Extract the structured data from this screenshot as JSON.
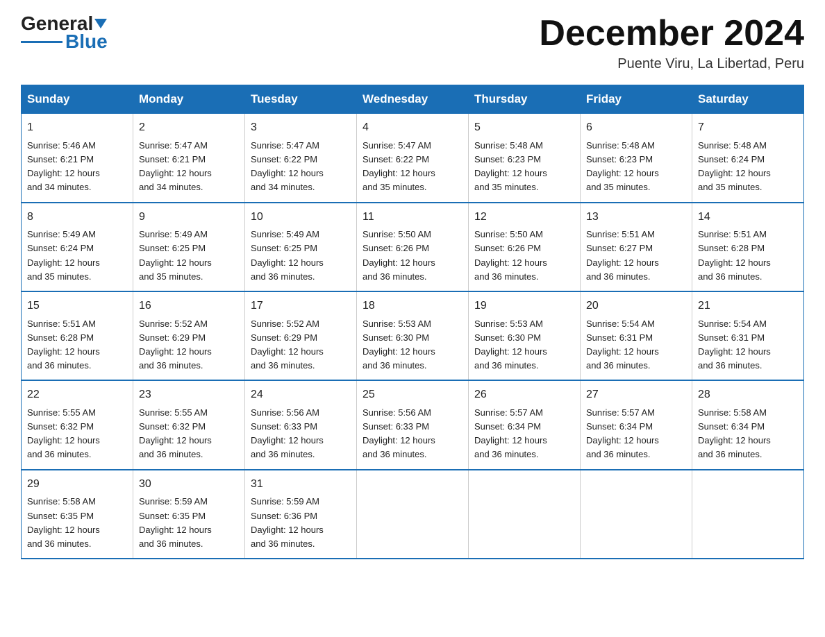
{
  "header": {
    "logo_general": "General",
    "logo_blue": "Blue",
    "month_title": "December 2024",
    "location": "Puente Viru, La Libertad, Peru"
  },
  "weekdays": [
    "Sunday",
    "Monday",
    "Tuesday",
    "Wednesday",
    "Thursday",
    "Friday",
    "Saturday"
  ],
  "weeks": [
    [
      {
        "day": "1",
        "info": "Sunrise: 5:46 AM\nSunset: 6:21 PM\nDaylight: 12 hours\nand 34 minutes."
      },
      {
        "day": "2",
        "info": "Sunrise: 5:47 AM\nSunset: 6:21 PM\nDaylight: 12 hours\nand 34 minutes."
      },
      {
        "day": "3",
        "info": "Sunrise: 5:47 AM\nSunset: 6:22 PM\nDaylight: 12 hours\nand 34 minutes."
      },
      {
        "day": "4",
        "info": "Sunrise: 5:47 AM\nSunset: 6:22 PM\nDaylight: 12 hours\nand 35 minutes."
      },
      {
        "day": "5",
        "info": "Sunrise: 5:48 AM\nSunset: 6:23 PM\nDaylight: 12 hours\nand 35 minutes."
      },
      {
        "day": "6",
        "info": "Sunrise: 5:48 AM\nSunset: 6:23 PM\nDaylight: 12 hours\nand 35 minutes."
      },
      {
        "day": "7",
        "info": "Sunrise: 5:48 AM\nSunset: 6:24 PM\nDaylight: 12 hours\nand 35 minutes."
      }
    ],
    [
      {
        "day": "8",
        "info": "Sunrise: 5:49 AM\nSunset: 6:24 PM\nDaylight: 12 hours\nand 35 minutes."
      },
      {
        "day": "9",
        "info": "Sunrise: 5:49 AM\nSunset: 6:25 PM\nDaylight: 12 hours\nand 35 minutes."
      },
      {
        "day": "10",
        "info": "Sunrise: 5:49 AM\nSunset: 6:25 PM\nDaylight: 12 hours\nand 36 minutes."
      },
      {
        "day": "11",
        "info": "Sunrise: 5:50 AM\nSunset: 6:26 PM\nDaylight: 12 hours\nand 36 minutes."
      },
      {
        "day": "12",
        "info": "Sunrise: 5:50 AM\nSunset: 6:26 PM\nDaylight: 12 hours\nand 36 minutes."
      },
      {
        "day": "13",
        "info": "Sunrise: 5:51 AM\nSunset: 6:27 PM\nDaylight: 12 hours\nand 36 minutes."
      },
      {
        "day": "14",
        "info": "Sunrise: 5:51 AM\nSunset: 6:28 PM\nDaylight: 12 hours\nand 36 minutes."
      }
    ],
    [
      {
        "day": "15",
        "info": "Sunrise: 5:51 AM\nSunset: 6:28 PM\nDaylight: 12 hours\nand 36 minutes."
      },
      {
        "day": "16",
        "info": "Sunrise: 5:52 AM\nSunset: 6:29 PM\nDaylight: 12 hours\nand 36 minutes."
      },
      {
        "day": "17",
        "info": "Sunrise: 5:52 AM\nSunset: 6:29 PM\nDaylight: 12 hours\nand 36 minutes."
      },
      {
        "day": "18",
        "info": "Sunrise: 5:53 AM\nSunset: 6:30 PM\nDaylight: 12 hours\nand 36 minutes."
      },
      {
        "day": "19",
        "info": "Sunrise: 5:53 AM\nSunset: 6:30 PM\nDaylight: 12 hours\nand 36 minutes."
      },
      {
        "day": "20",
        "info": "Sunrise: 5:54 AM\nSunset: 6:31 PM\nDaylight: 12 hours\nand 36 minutes."
      },
      {
        "day": "21",
        "info": "Sunrise: 5:54 AM\nSunset: 6:31 PM\nDaylight: 12 hours\nand 36 minutes."
      }
    ],
    [
      {
        "day": "22",
        "info": "Sunrise: 5:55 AM\nSunset: 6:32 PM\nDaylight: 12 hours\nand 36 minutes."
      },
      {
        "day": "23",
        "info": "Sunrise: 5:55 AM\nSunset: 6:32 PM\nDaylight: 12 hours\nand 36 minutes."
      },
      {
        "day": "24",
        "info": "Sunrise: 5:56 AM\nSunset: 6:33 PM\nDaylight: 12 hours\nand 36 minutes."
      },
      {
        "day": "25",
        "info": "Sunrise: 5:56 AM\nSunset: 6:33 PM\nDaylight: 12 hours\nand 36 minutes."
      },
      {
        "day": "26",
        "info": "Sunrise: 5:57 AM\nSunset: 6:34 PM\nDaylight: 12 hours\nand 36 minutes."
      },
      {
        "day": "27",
        "info": "Sunrise: 5:57 AM\nSunset: 6:34 PM\nDaylight: 12 hours\nand 36 minutes."
      },
      {
        "day": "28",
        "info": "Sunrise: 5:58 AM\nSunset: 6:34 PM\nDaylight: 12 hours\nand 36 minutes."
      }
    ],
    [
      {
        "day": "29",
        "info": "Sunrise: 5:58 AM\nSunset: 6:35 PM\nDaylight: 12 hours\nand 36 minutes."
      },
      {
        "day": "30",
        "info": "Sunrise: 5:59 AM\nSunset: 6:35 PM\nDaylight: 12 hours\nand 36 minutes."
      },
      {
        "day": "31",
        "info": "Sunrise: 5:59 AM\nSunset: 6:36 PM\nDaylight: 12 hours\nand 36 minutes."
      },
      {
        "day": "",
        "info": ""
      },
      {
        "day": "",
        "info": ""
      },
      {
        "day": "",
        "info": ""
      },
      {
        "day": "",
        "info": ""
      }
    ]
  ]
}
